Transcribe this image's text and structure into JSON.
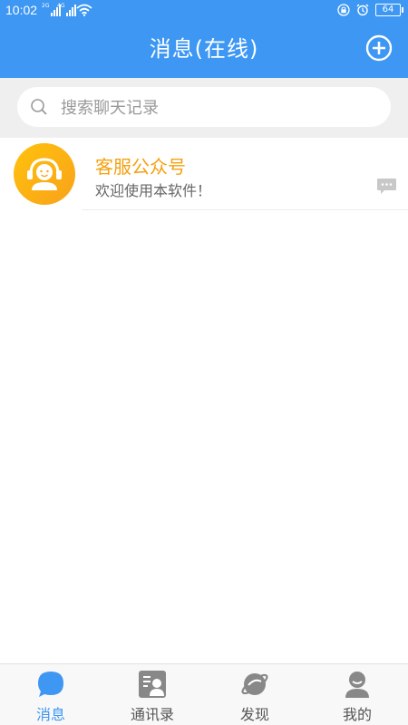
{
  "status_bar": {
    "time": "10:02",
    "signal1_label": "2G",
    "signal2_label": "4G",
    "battery": "64"
  },
  "header": {
    "title": "消息(在线)"
  },
  "search": {
    "placeholder": "搜索聊天记录"
  },
  "conversations": [
    {
      "name": "客服公众号",
      "preview": "欢迎使用本软件！"
    }
  ],
  "bottom_nav": {
    "tabs": [
      {
        "label": "消息",
        "icon": "chat-bubble-icon",
        "active": true
      },
      {
        "label": "通讯录",
        "icon": "contacts-icon",
        "active": false
      },
      {
        "label": "发现",
        "icon": "planet-icon",
        "active": false
      },
      {
        "label": "我的",
        "icon": "user-icon",
        "active": false
      }
    ]
  },
  "colors": {
    "primary": "#3D97F3",
    "accent": "#F5A10F",
    "avatar_gradient_start": "#FFC20D",
    "avatar_gradient_end": "#F9A219"
  }
}
